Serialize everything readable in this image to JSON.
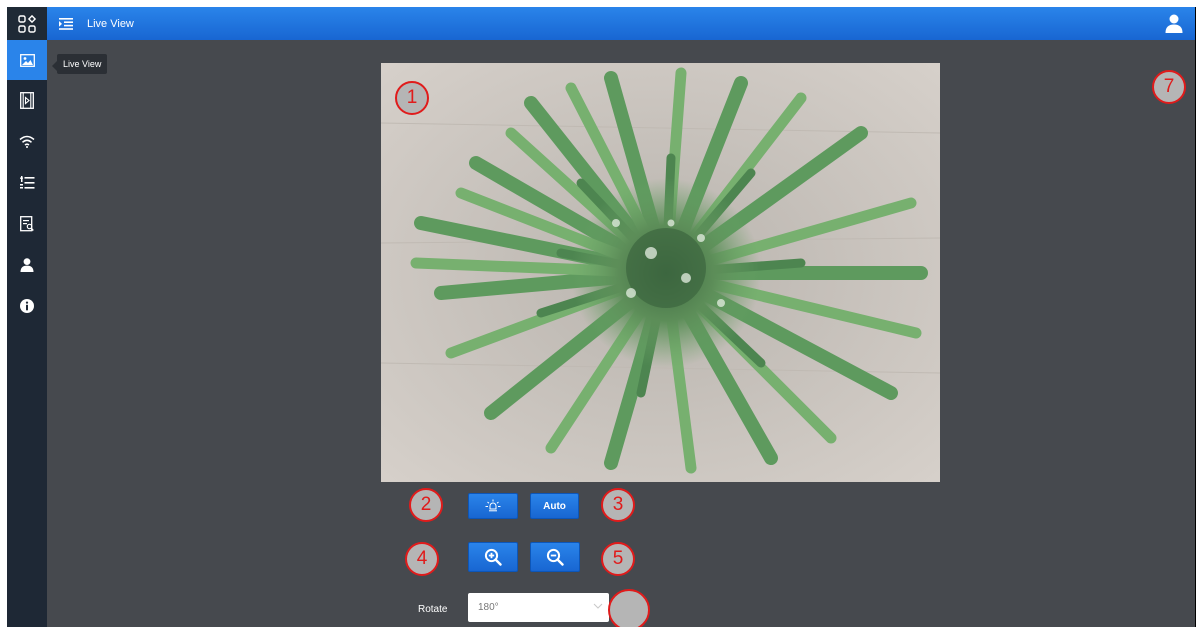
{
  "header": {
    "title": "Live View"
  },
  "tooltip": {
    "text": "Live View"
  },
  "sidebar": {
    "items": [
      {
        "name": "live-view",
        "icon": "image-icon",
        "active": true
      },
      {
        "name": "playback",
        "icon": "film-icon",
        "active": false
      },
      {
        "name": "network",
        "icon": "wifi-icon",
        "active": false
      },
      {
        "name": "list",
        "icon": "list-icon",
        "active": false
      },
      {
        "name": "logs",
        "icon": "report-icon",
        "active": false
      },
      {
        "name": "user",
        "icon": "user-icon",
        "active": false
      },
      {
        "name": "info",
        "icon": "info-icon",
        "active": false
      }
    ]
  },
  "controls": {
    "light_button": "light-icon",
    "auto_label": "Auto",
    "zoom_in": "zoom-in-icon",
    "zoom_out": "zoom-out-icon",
    "rotate_label": "Rotate",
    "rotate_value": "180°"
  },
  "markers": [
    "1",
    "2",
    "3",
    "4",
    "5",
    "7"
  ],
  "colors": {
    "accent": "#2a84ea",
    "sidebar": "#1e2835",
    "background": "#46494e",
    "marker": "#e01b1b"
  }
}
